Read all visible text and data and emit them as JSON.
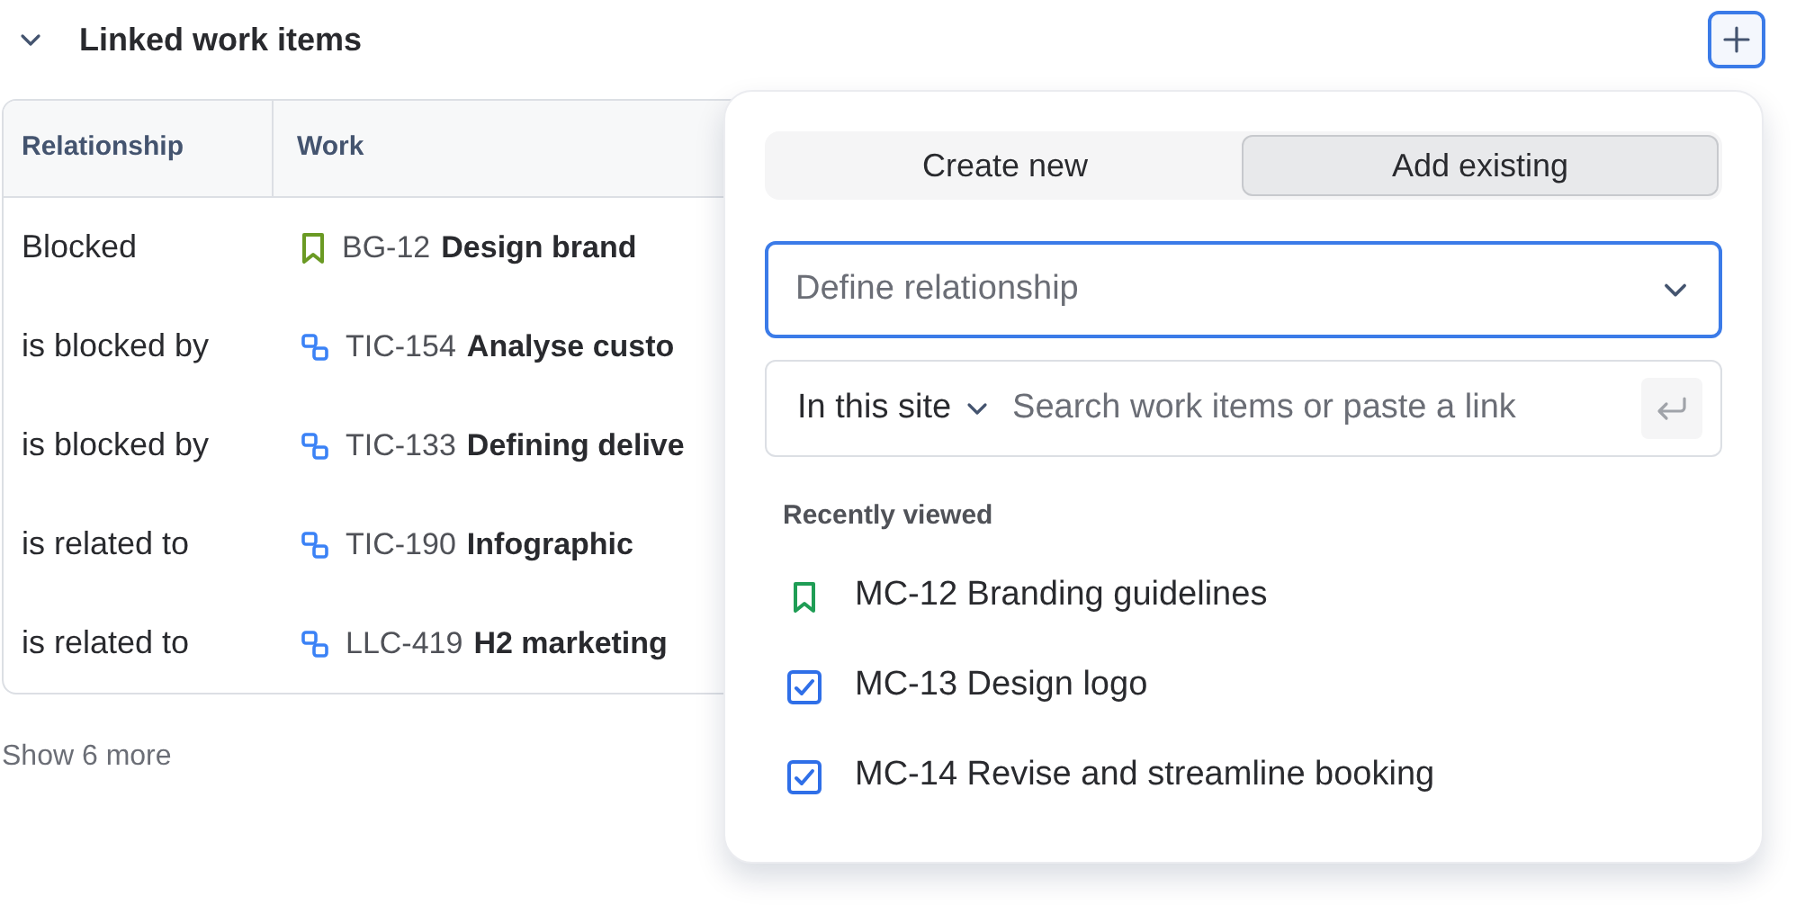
{
  "section": {
    "title": "Linked work items",
    "expanded": true
  },
  "table": {
    "columns": [
      "Relationship",
      "Work"
    ],
    "rows": [
      {
        "relationship": "Blocked",
        "kind": "story",
        "key": "BG-12",
        "summary": "Design brand"
      },
      {
        "relationship": "is blocked by",
        "kind": "subtask",
        "key": "TIC-154",
        "summary": "Analyse custo"
      },
      {
        "relationship": "is blocked by",
        "kind": "subtask",
        "key": "TIC-133",
        "summary": "Defining delive"
      },
      {
        "relationship": "is related to",
        "kind": "subtask",
        "key": "TIC-190",
        "summary": "Infographic"
      },
      {
        "relationship": "is related to",
        "kind": "subtask",
        "key": "LLC-419",
        "summary": "H2 marketing"
      }
    ]
  },
  "show_more": "Show 6 more",
  "popover": {
    "tabs": [
      {
        "label": "Create new",
        "selected": false
      },
      {
        "label": "Add existing",
        "selected": true
      }
    ],
    "relationship_select": {
      "placeholder": "Define relationship"
    },
    "scope": "In this site",
    "search": {
      "placeholder": "Search work items or paste a link"
    },
    "recent_heading": "Recently viewed",
    "recent": [
      {
        "kind": "story",
        "label": "MC-12 Branding guidelines"
      },
      {
        "kind": "task",
        "label": "MC-13 Design logo"
      },
      {
        "kind": "task",
        "label": "MC-14 Revise and streamline booking"
      }
    ]
  }
}
